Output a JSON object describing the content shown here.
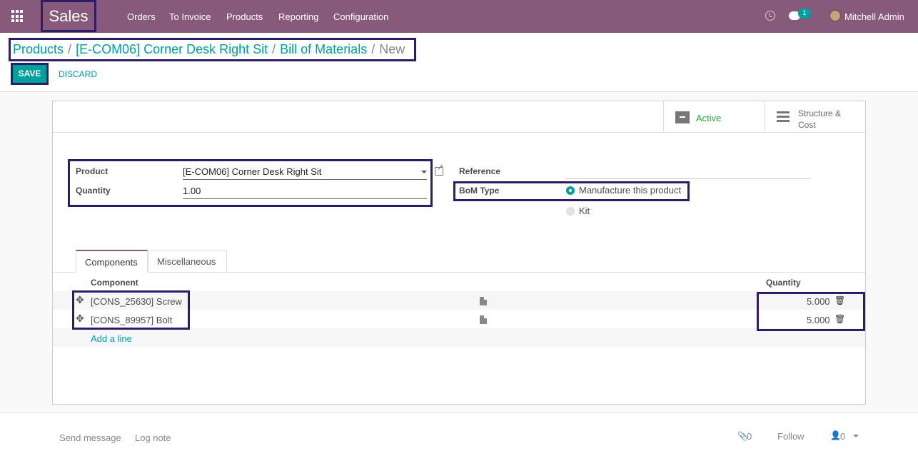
{
  "navbar": {
    "brand": "Sales",
    "menu": [
      "Orders",
      "To Invoice",
      "Products",
      "Reporting",
      "Configuration"
    ],
    "chat_count": "1",
    "user": "Mitchell Admin"
  },
  "breadcrumb": {
    "items": [
      "Products",
      "[E-COM06] Corner Desk Right Sit",
      "Bill of Materials"
    ],
    "current": "New"
  },
  "actions": {
    "save": "SAVE",
    "discard": "DISCARD"
  },
  "smart_buttons": {
    "active": "Active",
    "structure_line1": "Structure &",
    "structure_line2": "Cost"
  },
  "form": {
    "product_label": "Product",
    "product_value": "[E-COM06] Corner Desk Right Sit",
    "quantity_label": "Quantity",
    "quantity_value": "1.00",
    "reference_label": "Reference",
    "bom_type_label": "BoM Type",
    "bom_options": [
      "Manufacture this product",
      "Kit"
    ],
    "bom_selected": "Manufacture this product"
  },
  "tabs": [
    "Components",
    "Miscellaneous"
  ],
  "components": {
    "headers": {
      "component": "Component",
      "quantity": "Quantity"
    },
    "rows": [
      {
        "component": "[CONS_25630] Screw",
        "quantity": "5.000"
      },
      {
        "component": "[CONS_89957] Bolt",
        "quantity": "5.000"
      }
    ],
    "add_line": "Add a line"
  },
  "chatter": {
    "send_message": "Send message",
    "log_note": "Log note",
    "attachments": "0",
    "follow": "Follow",
    "followers": "0"
  },
  "colors": {
    "navbar": "#875a7b",
    "accent": "#00a09d",
    "highlight_border": "#2f1c66"
  }
}
